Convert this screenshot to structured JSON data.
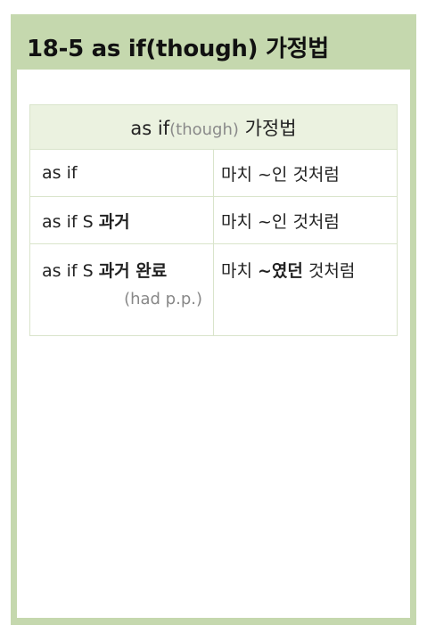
{
  "title": "18-5 as if(though) 가정법",
  "table": {
    "header": {
      "main": "as if",
      "sub": "(though)",
      "tail": "가정법"
    },
    "rows": [
      {
        "form": "as if",
        "meaning": "마치 ~인 것처럼"
      },
      {
        "form_prefix": "as if S",
        "form_bold": "과거",
        "meaning": "마치 ~인 것처럼"
      },
      {
        "form_prefix": "as if S",
        "form_bold": "과거 완료",
        "note": "(had p.p.)",
        "meaning_prefix": "마치",
        "meaning_bold": "~였던",
        "meaning_suffix": "것처럼"
      }
    ]
  },
  "colors": {
    "card_border": "#c5d8ae",
    "header_bg": "#ebf2e0",
    "grid_line": "#d9e4cb",
    "muted_text": "#888888"
  }
}
